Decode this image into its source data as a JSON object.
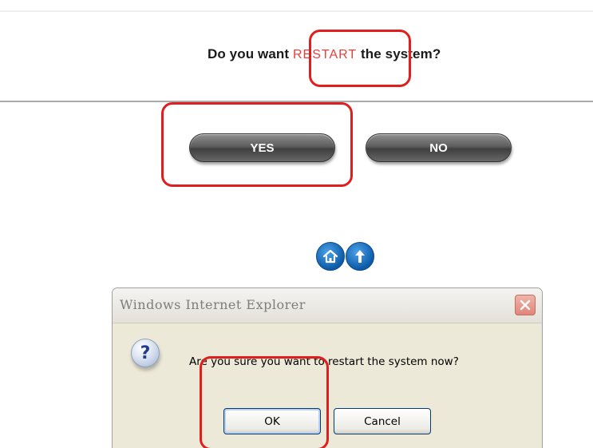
{
  "prompt": {
    "before": "Do you want ",
    "highlight": "RESTART",
    "after": " the system?"
  },
  "buttons": {
    "yes_label": "YES",
    "no_label": "NO"
  },
  "nav_icons": [
    "home-icon",
    "up-arrow-icon"
  ],
  "dialog": {
    "title": "Windows Internet Explorer",
    "icon": "question-icon",
    "message": "Are you sure you want to restart the system now?",
    "ok_label": "OK",
    "cancel_label": "Cancel"
  },
  "colors": {
    "restart_text": "#e8403b",
    "annotation_red": "#e01e1e",
    "icon_blue": "#1470c8"
  }
}
